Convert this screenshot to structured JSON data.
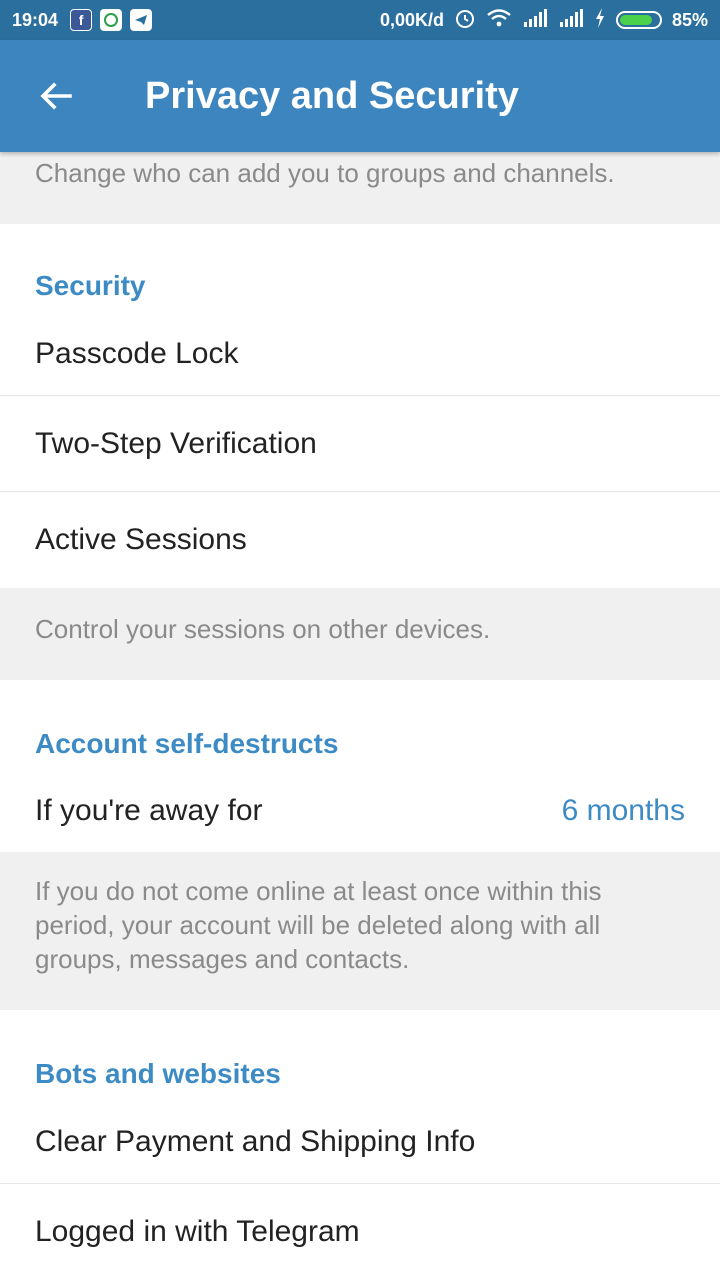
{
  "status_bar": {
    "time": "19:04",
    "app_icons": [
      "facebook-icon",
      "whatsapp-icon",
      "telegram-icon"
    ],
    "net_speed": "0,00K/d",
    "battery": "85%",
    "battery_level": 0.85
  },
  "toolbar": {
    "title": "Privacy and Security"
  },
  "groups_info": "Change who can add you to groups and channels.",
  "security": {
    "header": "Security",
    "items": [
      "Passcode Lock",
      "Two-Step Verification",
      "Active Sessions"
    ],
    "info": "Control your sessions on other devices."
  },
  "self_destruct": {
    "header": "Account self-destructs",
    "label": "If you're away for",
    "value": "6 months",
    "info": "If you do not come online at least once within this period, your account will be deleted along with all groups, messages and contacts."
  },
  "bots": {
    "header": "Bots and websites",
    "items": [
      "Clear Payment and Shipping Info",
      "Logged in with Telegram"
    ]
  },
  "colors": {
    "status_bar": "#2a6f9e",
    "toolbar": "#3d85bf",
    "accent": "#3d8bc4"
  }
}
